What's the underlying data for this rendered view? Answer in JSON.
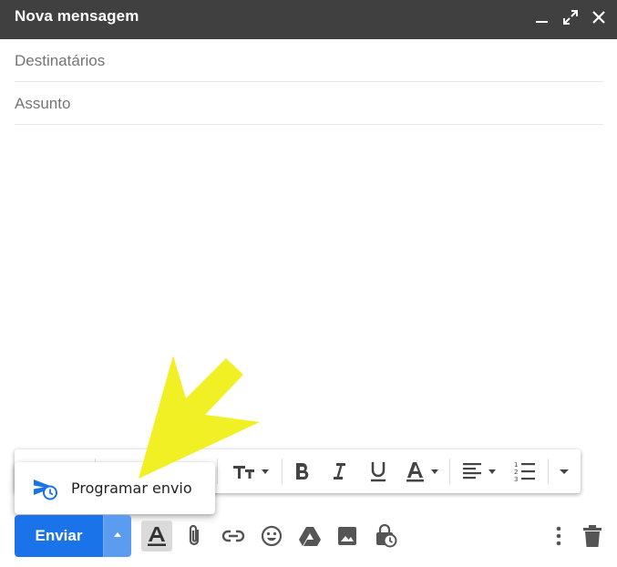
{
  "window": {
    "title": "Nova mensagem",
    "controls": [
      "minimize-icon",
      "expand-icon",
      "close-icon"
    ]
  },
  "fields": {
    "to_placeholder": "Destinatários",
    "subject_placeholder": "Assunto"
  },
  "format_toolbar": {
    "items": [
      "text-size-icon",
      "bold-icon",
      "italic-icon",
      "underline-icon",
      "text-color-icon",
      "align-icon",
      "numbered-list-icon",
      "more-formatting-icon"
    ]
  },
  "schedule_menu": {
    "label": "Programar envio",
    "icon": "schedule-send-icon"
  },
  "bottom_toolbar": {
    "send_label": "Enviar",
    "icons": [
      "formatting-options-icon",
      "attach-icon",
      "link-icon",
      "emoji-icon",
      "drive-icon",
      "photo-icon",
      "confidential-mode-icon",
      "more-options-icon",
      "discard-icon"
    ]
  },
  "colors": {
    "header_bg": "#404040",
    "send_blue": "#1a73e8",
    "arrow_yellow": "#f0f024"
  }
}
